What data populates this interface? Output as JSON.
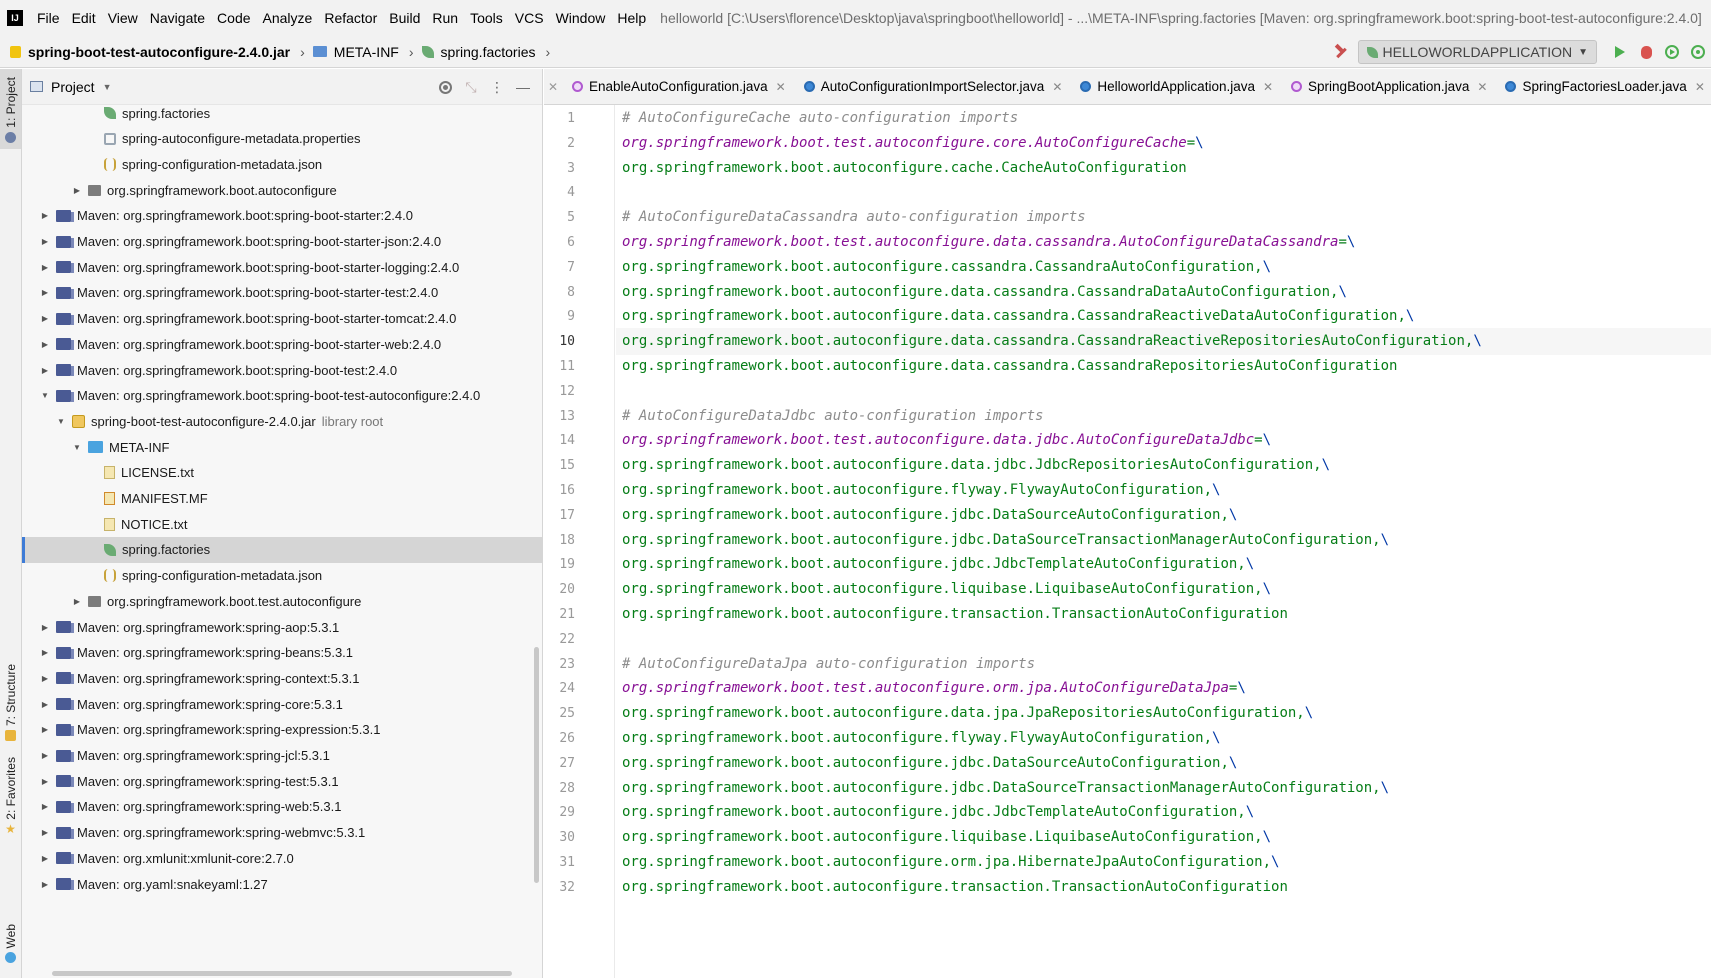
{
  "menubar": {
    "logo": "IJ",
    "items": [
      "File",
      "Edit",
      "View",
      "Navigate",
      "Code",
      "Analyze",
      "Refactor",
      "Build",
      "Run",
      "Tools",
      "VCS",
      "Window",
      "Help"
    ],
    "window_title": "helloworld [C:\\Users\\florence\\Desktop\\java\\springboot\\helloworld] - ...\\META-INF\\spring.factories [Maven: org.springframework.boot:spring-boot-test-autoconfigure:2.4.0]"
  },
  "navbar": {
    "crumbs": [
      "spring-boot-test-autoconfigure-2.4.0.jar",
      "META-INF",
      "spring.factories"
    ],
    "run_config": "HELLOWORLDAPPLICATION"
  },
  "left_strip": {
    "project": "1: Project",
    "structure": "7: Structure",
    "favorites": "2: Favorites",
    "web": "Web"
  },
  "project_panel": {
    "title": "Project",
    "rows": [
      {
        "indent": 82,
        "arrow": "",
        "icon": "leaf",
        "label": "spring.factories",
        "suffix": ""
      },
      {
        "indent": 82,
        "arrow": "",
        "icon": "props",
        "label": "spring-autoconfigure-metadata.properties",
        "suffix": ""
      },
      {
        "indent": 82,
        "arrow": "",
        "icon": "json",
        "label": "spring-configuration-metadata.json",
        "suffix": ""
      },
      {
        "indent": 48,
        "arrow": "›",
        "icon": "pkg",
        "label": "org.springframework.boot.autoconfigure",
        "suffix": ""
      },
      {
        "indent": 16,
        "arrow": "›",
        "icon": "lib",
        "label": "Maven: org.springframework.boot:spring-boot-starter:2.4.0",
        "suffix": ""
      },
      {
        "indent": 16,
        "arrow": "›",
        "icon": "lib",
        "label": "Maven: org.springframework.boot:spring-boot-starter-json:2.4.0",
        "suffix": ""
      },
      {
        "indent": 16,
        "arrow": "›",
        "icon": "lib",
        "label": "Maven: org.springframework.boot:spring-boot-starter-logging:2.4.0",
        "suffix": ""
      },
      {
        "indent": 16,
        "arrow": "›",
        "icon": "lib",
        "label": "Maven: org.springframework.boot:spring-boot-starter-test:2.4.0",
        "suffix": ""
      },
      {
        "indent": 16,
        "arrow": "›",
        "icon": "lib",
        "label": "Maven: org.springframework.boot:spring-boot-starter-tomcat:2.4.0",
        "suffix": ""
      },
      {
        "indent": 16,
        "arrow": "›",
        "icon": "lib",
        "label": "Maven: org.springframework.boot:spring-boot-starter-web:2.4.0",
        "suffix": ""
      },
      {
        "indent": 16,
        "arrow": "›",
        "icon": "lib",
        "label": "Maven: org.springframework.boot:spring-boot-test:2.4.0",
        "suffix": ""
      },
      {
        "indent": 16,
        "arrow": "⌄",
        "icon": "lib",
        "label": "Maven: org.springframework.boot:spring-boot-test-autoconfigure:2.4.0",
        "suffix": ""
      },
      {
        "indent": 32,
        "arrow": "⌄",
        "icon": "jar",
        "label": "spring-boot-test-autoconfigure-2.4.0.jar",
        "suffix": "library root"
      },
      {
        "indent": 48,
        "arrow": "⌄",
        "icon": "folder",
        "label": "META-INF",
        "suffix": ""
      },
      {
        "indent": 82,
        "arrow": "",
        "icon": "txt",
        "label": "LICENSE.txt",
        "suffix": ""
      },
      {
        "indent": 82,
        "arrow": "",
        "icon": "mf",
        "label": "MANIFEST.MF",
        "suffix": ""
      },
      {
        "indent": 82,
        "arrow": "",
        "icon": "txt",
        "label": "NOTICE.txt",
        "suffix": ""
      },
      {
        "indent": 82,
        "arrow": "",
        "icon": "leaf",
        "label": "spring.factories",
        "suffix": "",
        "selected": true
      },
      {
        "indent": 82,
        "arrow": "",
        "icon": "json",
        "label": "spring-configuration-metadata.json",
        "suffix": ""
      },
      {
        "indent": 48,
        "arrow": "›",
        "icon": "pkg",
        "label": "org.springframework.boot.test.autoconfigure",
        "suffix": ""
      },
      {
        "indent": 16,
        "arrow": "›",
        "icon": "lib",
        "label": "Maven: org.springframework:spring-aop:5.3.1",
        "suffix": ""
      },
      {
        "indent": 16,
        "arrow": "›",
        "icon": "lib",
        "label": "Maven: org.springframework:spring-beans:5.3.1",
        "suffix": ""
      },
      {
        "indent": 16,
        "arrow": "›",
        "icon": "lib",
        "label": "Maven: org.springframework:spring-context:5.3.1",
        "suffix": ""
      },
      {
        "indent": 16,
        "arrow": "›",
        "icon": "lib",
        "label": "Maven: org.springframework:spring-core:5.3.1",
        "suffix": ""
      },
      {
        "indent": 16,
        "arrow": "›",
        "icon": "lib",
        "label": "Maven: org.springframework:spring-expression:5.3.1",
        "suffix": ""
      },
      {
        "indent": 16,
        "arrow": "›",
        "icon": "lib",
        "label": "Maven: org.springframework:spring-jcl:5.3.1",
        "suffix": ""
      },
      {
        "indent": 16,
        "arrow": "›",
        "icon": "lib",
        "label": "Maven: org.springframework:spring-test:5.3.1",
        "suffix": ""
      },
      {
        "indent": 16,
        "arrow": "›",
        "icon": "lib",
        "label": "Maven: org.springframework:spring-web:5.3.1",
        "suffix": ""
      },
      {
        "indent": 16,
        "arrow": "›",
        "icon": "lib",
        "label": "Maven: org.springframework:spring-webmvc:5.3.1",
        "suffix": ""
      },
      {
        "indent": 16,
        "arrow": "›",
        "icon": "lib",
        "label": "Maven: org.xmlunit:xmlunit-core:2.7.0",
        "suffix": ""
      },
      {
        "indent": 16,
        "arrow": "›",
        "icon": "lib",
        "label": "Maven: org.yaml:snakeyaml:1.27",
        "suffix": ""
      }
    ]
  },
  "editor": {
    "tabs": [
      {
        "label": "EnableAutoConfiguration.java",
        "icon": "anno"
      },
      {
        "label": "AutoConfigurationImportSelector.java",
        "icon": "cls"
      },
      {
        "label": "HelloworldApplication.java",
        "icon": "cls"
      },
      {
        "label": "SpringBootApplication.java",
        "icon": "anno"
      },
      {
        "label": "SpringFactoriesLoader.java",
        "icon": "cls"
      }
    ],
    "current_line": 10,
    "lines": [
      {
        "n": "1",
        "type": "comment",
        "text": "# AutoConfigureCache auto-configuration imports"
      },
      {
        "n": "2",
        "type": "key",
        "text": "org.springframework.boot.test.autoconfigure.core.AutoConfigureCache"
      },
      {
        "n": "3",
        "type": "val",
        "text": "org.springframework.boot.autoconfigure.cache.CacheAutoConfiguration"
      },
      {
        "n": "4",
        "type": "blank",
        "text": ""
      },
      {
        "n": "5",
        "type": "comment",
        "text": "# AutoConfigureDataCassandra auto-configuration imports"
      },
      {
        "n": "6",
        "type": "key",
        "text": "org.springframework.boot.test.autoconfigure.data.cassandra.AutoConfigureDataCassandra"
      },
      {
        "n": "7",
        "type": "val",
        "text": "org.springframework.boot.autoconfigure.cassandra.CassandraAutoConfiguration,"
      },
      {
        "n": "8",
        "type": "val",
        "text": "org.springframework.boot.autoconfigure.data.cassandra.CassandraDataAutoConfiguration,"
      },
      {
        "n": "9",
        "type": "val",
        "text": "org.springframework.boot.autoconfigure.data.cassandra.CassandraReactiveDataAutoConfiguration,"
      },
      {
        "n": "10",
        "type": "val",
        "text": "org.springframework.boot.autoconfigure.data.cassandra.CassandraReactiveRepositoriesAutoConfiguration,"
      },
      {
        "n": "11",
        "type": "val",
        "text": "org.springframework.boot.autoconfigure.data.cassandra.CassandraRepositoriesAutoConfiguration"
      },
      {
        "n": "12",
        "type": "blank",
        "text": ""
      },
      {
        "n": "13",
        "type": "comment",
        "text": "# AutoConfigureDataJdbc auto-configuration imports"
      },
      {
        "n": "14",
        "type": "key",
        "text": "org.springframework.boot.test.autoconfigure.data.jdbc.AutoConfigureDataJdbc"
      },
      {
        "n": "15",
        "type": "val",
        "text": "org.springframework.boot.autoconfigure.data.jdbc.JdbcRepositoriesAutoConfiguration,"
      },
      {
        "n": "16",
        "type": "val",
        "text": "org.springframework.boot.autoconfigure.flyway.FlywayAutoConfiguration,"
      },
      {
        "n": "17",
        "type": "val",
        "text": "org.springframework.boot.autoconfigure.jdbc.DataSourceAutoConfiguration,"
      },
      {
        "n": "18",
        "type": "val",
        "text": "org.springframework.boot.autoconfigure.jdbc.DataSourceTransactionManagerAutoConfiguration,"
      },
      {
        "n": "19",
        "type": "val",
        "text": "org.springframework.boot.autoconfigure.jdbc.JdbcTemplateAutoConfiguration,"
      },
      {
        "n": "20",
        "type": "val",
        "text": "org.springframework.boot.autoconfigure.liquibase.LiquibaseAutoConfiguration,"
      },
      {
        "n": "21",
        "type": "val",
        "text": "org.springframework.boot.autoconfigure.transaction.TransactionAutoConfiguration"
      },
      {
        "n": "22",
        "type": "blank",
        "text": ""
      },
      {
        "n": "23",
        "type": "comment",
        "text": "# AutoConfigureDataJpa auto-configuration imports"
      },
      {
        "n": "24",
        "type": "key",
        "text": "org.springframework.boot.test.autoconfigure.orm.jpa.AutoConfigureDataJpa"
      },
      {
        "n": "25",
        "type": "val",
        "text": "org.springframework.boot.autoconfigure.data.jpa.JpaRepositoriesAutoConfiguration,"
      },
      {
        "n": "26",
        "type": "val",
        "text": "org.springframework.boot.autoconfigure.flyway.FlywayAutoConfiguration,"
      },
      {
        "n": "27",
        "type": "val",
        "text": "org.springframework.boot.autoconfigure.jdbc.DataSourceAutoConfiguration,"
      },
      {
        "n": "28",
        "type": "val",
        "text": "org.springframework.boot.autoconfigure.jdbc.DataSourceTransactionManagerAutoConfiguration,"
      },
      {
        "n": "29",
        "type": "val",
        "text": "org.springframework.boot.autoconfigure.jdbc.JdbcTemplateAutoConfiguration,"
      },
      {
        "n": "30",
        "type": "val",
        "text": "org.springframework.boot.autoconfigure.liquibase.LiquibaseAutoConfiguration,"
      },
      {
        "n": "31",
        "type": "val",
        "text": "org.springframework.boot.autoconfigure.orm.jpa.HibernateJpaAutoConfiguration,"
      },
      {
        "n": "32",
        "type": "val",
        "text": "org.springframework.boot.autoconfigure.transaction.TransactionAutoConfiguration"
      }
    ]
  },
  "colors": {
    "key": "#871094",
    "value": "#067d17",
    "comment": "#8c8c8c",
    "selection_accent": "#3d7bd6"
  }
}
